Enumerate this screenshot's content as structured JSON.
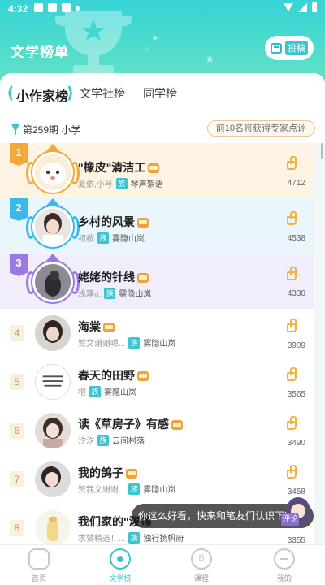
{
  "status_bar": {
    "time": "4:32"
  },
  "header": {
    "title": "文学榜单",
    "submit_label": "投稿"
  },
  "tabs": [
    {
      "label": "小作家榜",
      "active": true
    },
    {
      "label": "文学社榜",
      "active": false
    },
    {
      "label": "同学榜",
      "active": false
    }
  ],
  "issue": {
    "period": "第259期",
    "grade": "小学",
    "note": "前10名将获得专家点评"
  },
  "ranking": [
    {
      "rank": "1",
      "title": "\"橡皮\"清洁工",
      "author": "夏依,小号",
      "club_tag": "族",
      "club": "琴声絮语",
      "likes": "4712",
      "accent": "#f0a93a",
      "bg": "#fff3e4"
    },
    {
      "rank": "2",
      "title": "乡村的风景",
      "author": "初桉",
      "club_tag": "族",
      "club": "雾隐山岚",
      "likes": "4538",
      "accent": "#3ab9e8",
      "bg": "#e9f6fb"
    },
    {
      "rank": "3",
      "title": "姥姥的针线",
      "author": "浅瑾o.",
      "club_tag": "族",
      "club": "雾隐山岚",
      "likes": "4330",
      "accent": "#9a7ae0",
      "bg": "#f1edfb"
    },
    {
      "rank": "4",
      "title": "海棠",
      "author": "赞文谢谢嗯...",
      "club_tag": "族",
      "club": "雾隐山岚",
      "likes": "3909"
    },
    {
      "rank": "5",
      "title": "春天的田野",
      "author": "棍",
      "club_tag": "族",
      "club": "雾隐山岚",
      "likes": "3565"
    },
    {
      "rank": "6",
      "title": "读《草房子》有感",
      "author": "汐汐",
      "club_tag": "族",
      "club": "云间村落",
      "likes": "3490"
    },
    {
      "rank": "7",
      "title": "我的鸽子",
      "author": "赞我文谢谢...",
      "club_tag": "族",
      "club": "雾隐山岚",
      "likes": "3458"
    },
    {
      "rank": "8",
      "title": "我们家的\"泼猴",
      "author": "求赞精选！...",
      "club_tag": "族",
      "club": "独行扬帆府",
      "likes": "3355"
    }
  ],
  "toast": {
    "text": "你这么好看，快来和笔友们认识下吧",
    "tag": "评论"
  },
  "bottom_nav": [
    {
      "label": "首页",
      "active": false,
      "icon": "home-icon"
    },
    {
      "label": "文学榜",
      "active": true,
      "icon": "rank-icon"
    },
    {
      "label": "课程",
      "active": false,
      "icon": "course-icon"
    },
    {
      "label": "我的",
      "active": false,
      "icon": "profile-icon"
    }
  ],
  "colors": {
    "primary": "#3cc4cf",
    "header_gradient_top": "#37d3d6",
    "like": "#f0b43a"
  }
}
